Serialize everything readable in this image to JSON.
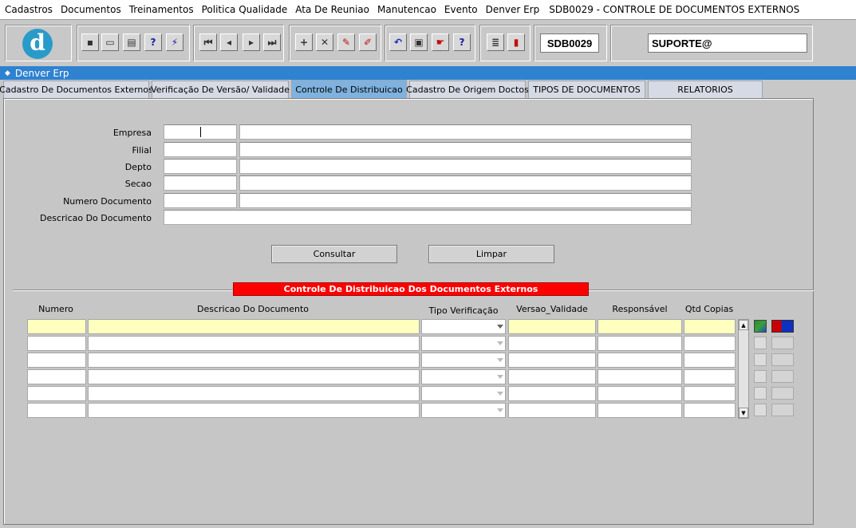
{
  "menu": {
    "items": [
      {
        "label": "Cadastros"
      },
      {
        "label": "Documentos"
      },
      {
        "label": "Treinamentos"
      },
      {
        "label": "Politica Qualidade"
      },
      {
        "label": "Ata De Reuniao"
      },
      {
        "label": "Manutencao"
      },
      {
        "label": "Evento"
      },
      {
        "label": "Denver Erp"
      }
    ],
    "title": "SDB0029 - CONTROLE DE DOCUMENTOS EXTERNOS"
  },
  "toolbar": {
    "logo": "d",
    "form_code": "SDB0029",
    "user": "SUPORTE@",
    "buttons": [
      "save-icon",
      "print-preview-icon",
      "printer-icon",
      "query-help-icon",
      "execute-query-icon",
      "first-record-icon",
      "previous-record-icon",
      "next-record-icon",
      "last-record-icon",
      "insert-record-icon",
      "delete-record-icon",
      "edit-record-icon",
      "clear-record-icon",
      "undo-icon",
      "clipboard-icon",
      "tools-icon",
      "help-icon",
      "menu-icon",
      "exit-icon"
    ]
  },
  "window": {
    "title": "Denver Erp"
  },
  "tabs": [
    {
      "label": "Cadastro De Documentos Externos",
      "active": false
    },
    {
      "label": "Verificação De Versão/ Validade",
      "active": false
    },
    {
      "label": "Controle De Distribuicao",
      "active": true
    },
    {
      "label": "Cadastro De Origem Doctos",
      "active": false
    },
    {
      "label": "TIPOS DE DOCUMENTOS",
      "active": false
    },
    {
      "label": "RELATORIOS",
      "active": false
    }
  ],
  "filters": {
    "empresa_label": "Empresa",
    "filial_label": "Filial",
    "depto_label": "Depto",
    "secao_label": "Secao",
    "numero_label": "Numero Documento",
    "descricao_label": "Descricao Do Documento"
  },
  "actions": {
    "consultar": "Consultar",
    "limpar": "Limpar"
  },
  "grid": {
    "title": "Controle De Distribuicao Dos Documentos Externos",
    "columns": {
      "numero": "Numero",
      "descricao": "Descricao Do Documento",
      "tipo": "Tipo Verificação",
      "versao": "Versao_Validade",
      "responsavel": "Responsável",
      "qtd": "Qtd Copias"
    },
    "row_count": 6
  }
}
